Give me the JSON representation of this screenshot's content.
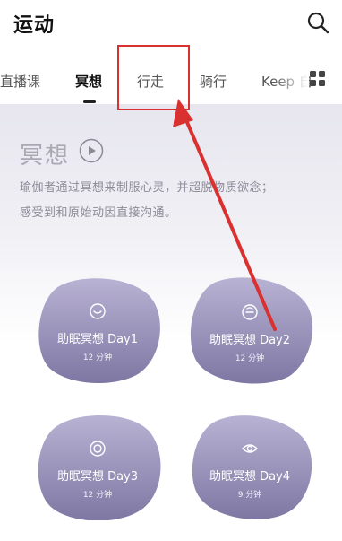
{
  "header": {
    "title": "运动"
  },
  "tabs": [
    {
      "label": "直播课"
    },
    {
      "label": "冥想"
    },
    {
      "label": "行走"
    },
    {
      "label": "骑行"
    },
    {
      "label": "Keep 自"
    }
  ],
  "hero": {
    "title": "冥想",
    "description_line1": "瑜伽者通过冥想来制服心灵，并超脱物质欲念；",
    "description_line2": "感受到和原始动因直接沟通。"
  },
  "cards": [
    {
      "title": "助眠冥想 Day1",
      "duration": "12 分钟",
      "icon": "smile-face-icon"
    },
    {
      "title": "助眠冥想 Day2",
      "duration": "12 分钟",
      "icon": "neutral-face-icon"
    },
    {
      "title": "助眠冥想 Day3",
      "duration": "12 分钟",
      "icon": "concentric-circle-icon"
    },
    {
      "title": "助眠冥想 Day4",
      "duration": "9 分钟",
      "icon": "eye-icon"
    }
  ],
  "colors": {
    "card_top": "#b7b1d2",
    "card_bottom": "#7f79a4",
    "annotation": "#d93030",
    "accent_text": "#111111"
  }
}
